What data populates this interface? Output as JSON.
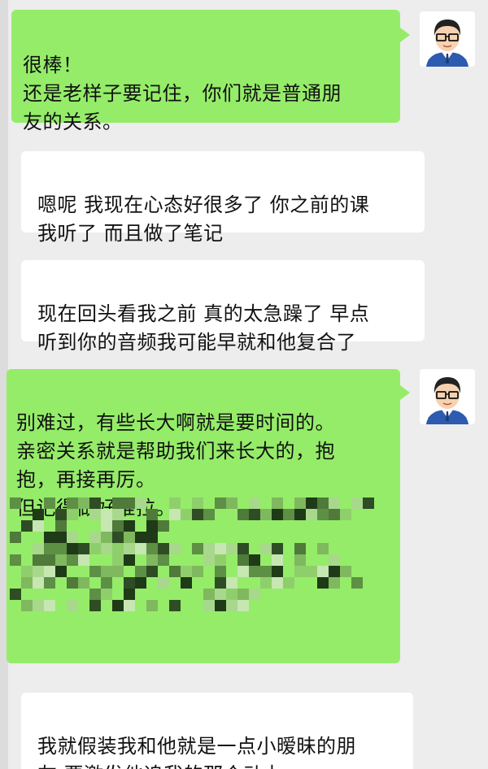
{
  "messages": [
    {
      "side": "me",
      "text": "很棒！\n还是老样子要记住，你们就是普通朋\n友的关系。"
    },
    {
      "side": "other",
      "text": "嗯呢 我现在心态好很多了 你之前的课\n我听了 而且做了笔记"
    },
    {
      "side": "other",
      "text": "现在回头看我之前 真的太急躁了 早点\n听到你的音频我可能早就和他复合了"
    },
    {
      "side": "me",
      "text": "别难过，有些长大啊就是要时间的。\n亲密关系就是帮助我们来长大的，抱\n抱，再接再厉。\n但记得做好推拉。"
    },
    {
      "side": "other",
      "text": "我就假装我和他就是一点小暧昧的朋\n友 要激发他追我的那个动力"
    }
  ],
  "colors": {
    "background": "#ededed",
    "my_bubble": "#95ec69",
    "other_bubble": "#ffffff"
  }
}
